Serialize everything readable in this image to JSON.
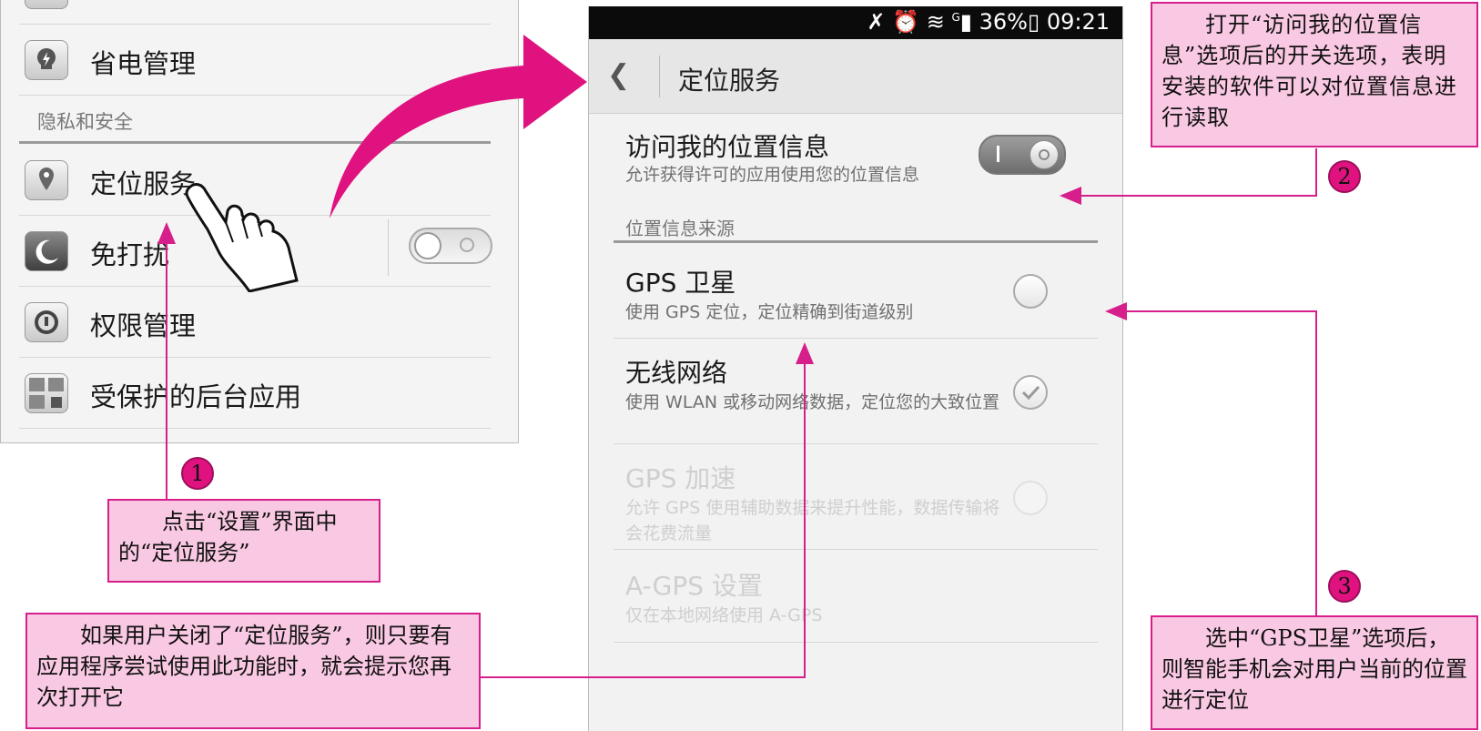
{
  "left_settings": {
    "items": [
      {
        "label": "省电管理",
        "icon": "power-saving-icon"
      },
      {
        "label": "定位服务",
        "icon": "location-icon"
      },
      {
        "label": "免打扰",
        "icon": "moon-icon"
      },
      {
        "label": "权限管理",
        "icon": "lock-icon"
      },
      {
        "label": "受保护的后台应用",
        "icon": "protected-apps-icon"
      }
    ],
    "section_header": "隐私和安全"
  },
  "phone": {
    "status_bar": {
      "signal_label": "G",
      "battery": "36%",
      "time": "09:21"
    },
    "app_bar": {
      "title": "定位服务",
      "back_icon": "back-chevron-icon"
    },
    "access_location": {
      "title": "访问我的位置信息",
      "subtitle": "允许获得许可的应用使用您的位置信息",
      "toggle_on": true
    },
    "section_header": "位置信息来源",
    "options": [
      {
        "title": "GPS 卫星",
        "subtitle": "使用 GPS 定位，定位精确到街道级别",
        "selected": false,
        "enabled": true
      },
      {
        "title": "无线网络",
        "subtitle": "使用 WLAN 或移动网络数据，定位您的大致位置",
        "selected": true,
        "enabled": true
      },
      {
        "title": "GPS 加速",
        "subtitle": "允许 GPS 使用辅助数据来提升性能，数据传输将会花费流量",
        "selected": false,
        "enabled": false
      },
      {
        "title": "A-GPS 设置",
        "subtitle": "仅在本地网络使用 A-GPS",
        "enabled": false
      }
    ]
  },
  "callouts": {
    "step1": {
      "number": "1",
      "text": "点击“设置”界面中的“定位服务”"
    },
    "step2": {
      "number": "2",
      "text": "打开“访问我的位置信息”选项后的开关选项，表明安装的软件可以对位置信息进行读取"
    },
    "step3": {
      "number": "3",
      "text": "选中“GPS卫星”选项后，则智能手机会对用户当前的位置进行定位"
    },
    "note": {
      "text": "如果用户关闭了“定位服务”，则只要有应用程序尝试使用此功能时，就会提示您再次打开它"
    }
  },
  "colors": {
    "accent": "#e0127f",
    "callout_fill": "#f9c8e3",
    "callout_border": "#d61f8a"
  }
}
